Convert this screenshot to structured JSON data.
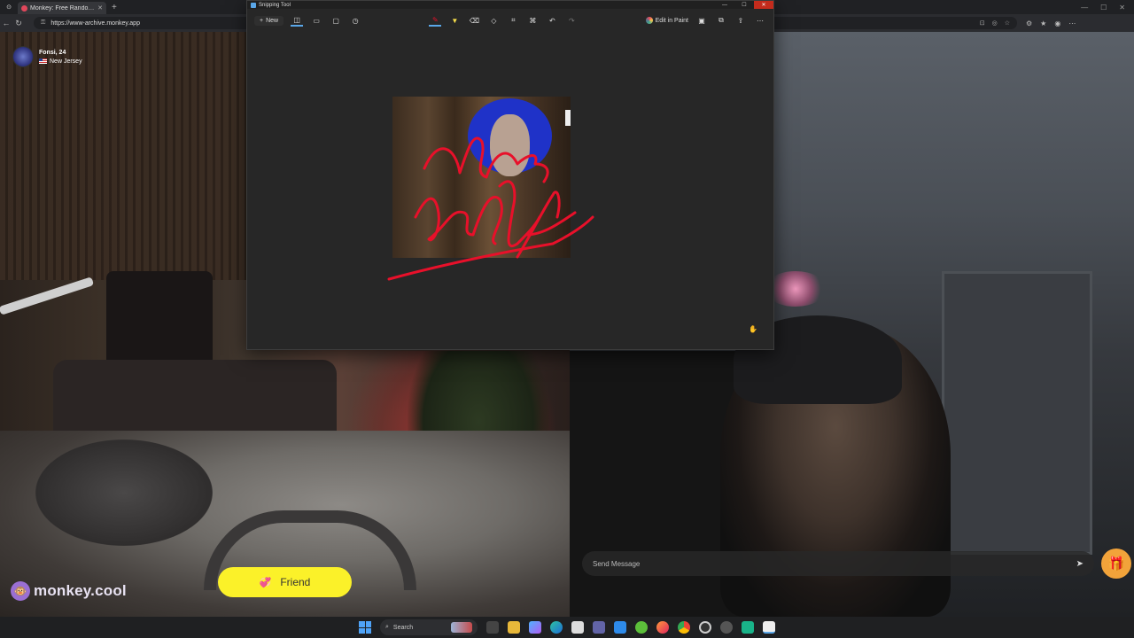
{
  "browser": {
    "tab_title": "Monkey: Free Random Video Chat",
    "url": "https://www-archive.monkey.app",
    "new_tab_symbol": "+"
  },
  "snipping_tool": {
    "title": "Snipping Tool",
    "new_label": "New",
    "edit_in_paint_label": "Edit in Paint",
    "icons": [
      "camera-icon",
      "video-icon",
      "rectangle-mode-icon",
      "timer-icon",
      "ballpoint-pen-icon",
      "highlighter-icon",
      "eraser-icon",
      "shapes-icon",
      "crop-icon",
      "text-actions-icon",
      "undo-icon",
      "redo-icon",
      "save-icon",
      "copy-icon",
      "share-icon",
      "more-icon"
    ],
    "accent_color": "#5aa7e8",
    "close_color": "#c42b1c",
    "ink_color": "#e8102a"
  },
  "partner": {
    "name_age": "Fonsi, 24",
    "location": "New Jersey",
    "flag": "us-flag-icon"
  },
  "brand": {
    "name": "monkey.cool"
  },
  "actions": {
    "friend_label": "Friend",
    "friend_color": "#fbf129",
    "message_placeholder": "Send Message",
    "gift_icon": "gift-icon"
  },
  "taskbar": {
    "search_label": "Search",
    "app_icons": [
      "task-view-icon",
      "file-explorer-icon",
      "copilot-icon",
      "edge-icon",
      "store-icon",
      "teams-icon",
      "photos-icon",
      "xbox-icon",
      "firefox-icon",
      "chrome-icon",
      "obs-icon",
      "media-player-icon",
      "terminal-icon",
      "snipping-tool-icon"
    ]
  }
}
